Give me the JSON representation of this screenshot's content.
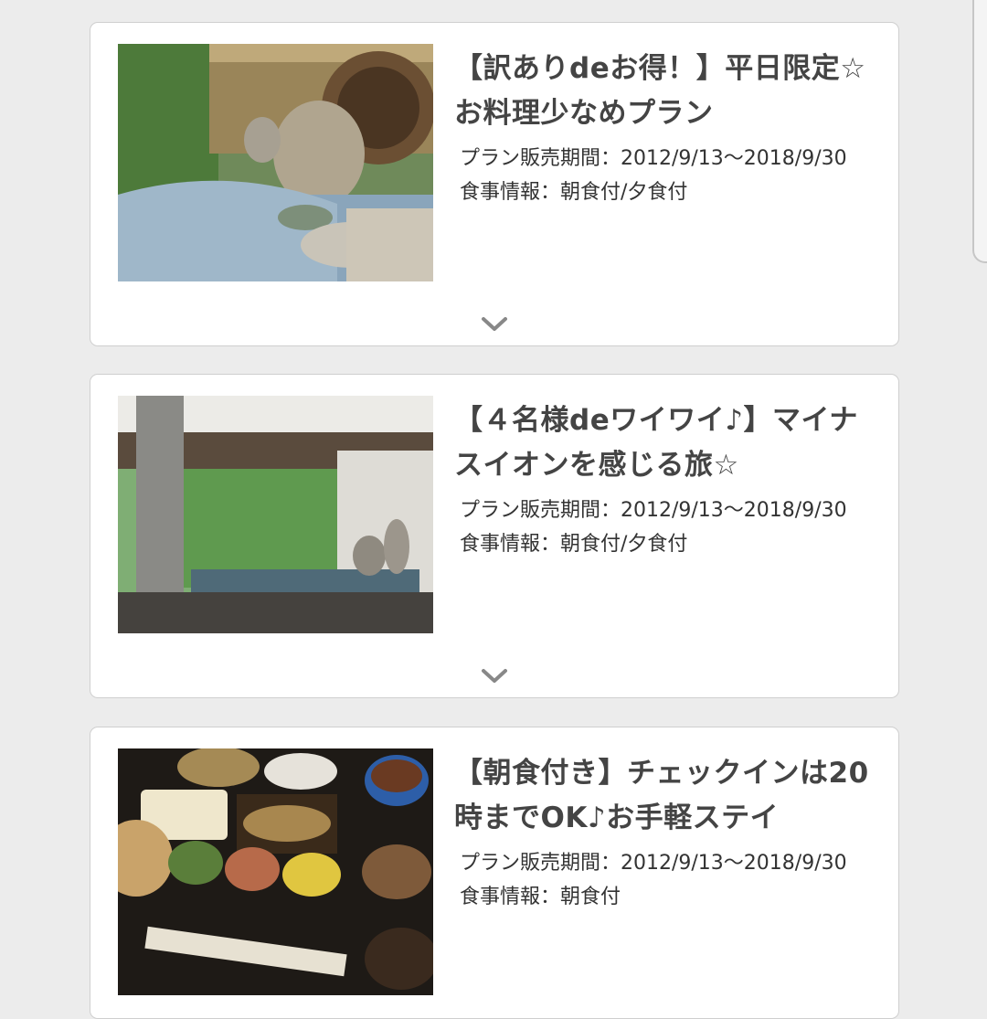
{
  "plans": [
    {
      "title": "【訳ありdeお得！】平日限定☆お料理少なめプラン",
      "sale_period": "プラン販売期間：2012/9/13〜2018/9/30",
      "meal_info": "食事情報：朝食付/夕食付",
      "photo_icon": "outdoor-bath-photo-icon"
    },
    {
      "title": "【４名様deワイワイ♪】マイナスイオンを感じる旅☆",
      "sale_period": "プラン販売期間：2012/9/13〜2018/9/30",
      "meal_info": "食事情報：朝食付/夕食付",
      "photo_icon": "indoor-bath-photo-icon"
    },
    {
      "title": "【朝食付き】チェックインは20時までOK♪お手軽ステイ",
      "sale_period": "プラン販売期間：2012/9/13〜2018/9/30",
      "meal_info": "食事情報：朝食付",
      "photo_icon": "breakfast-photo-icon"
    }
  ],
  "expand_icon": "chevron-down-icon",
  "colors": {
    "background": "#ececec",
    "card": "#ffffff",
    "title_text": "#444444",
    "chevron": "#888888"
  }
}
